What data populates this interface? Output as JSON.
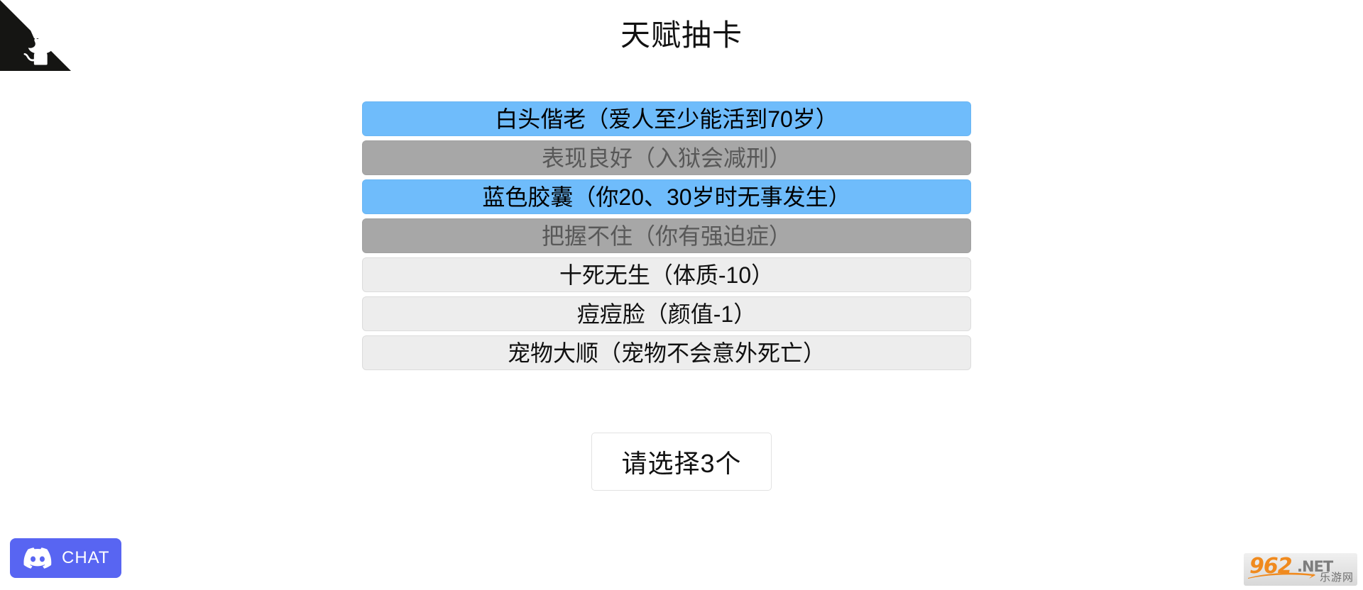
{
  "page": {
    "title": "天赋抽卡",
    "background_color": "#ffffff"
  },
  "github_corner": {
    "icon": "octocat-icon",
    "ribbon_color": "#151513",
    "mark_color": "#ffffff"
  },
  "cards": [
    {
      "label": "白头偕老（爱人至少能活到70岁）",
      "state": "selected",
      "color": "#6fbcfb"
    },
    {
      "label": "表现良好（入狱会减刑）",
      "state": "disabled",
      "color": "#a7a7a7"
    },
    {
      "label": "蓝色胶囊（你20、30岁时无事发生）",
      "state": "selected",
      "color": "#6fbcfb"
    },
    {
      "label": "把握不住（你有强迫症）",
      "state": "disabled",
      "color": "#a7a7a7"
    },
    {
      "label": "十死无生（体质-10）",
      "state": "normal",
      "color": "#ededed"
    },
    {
      "label": "痘痘脸（颜值-1）",
      "state": "normal",
      "color": "#ededed"
    },
    {
      "label": "宠物大顺（宠物不会意外死亡）",
      "state": "normal",
      "color": "#ededed"
    }
  ],
  "action": {
    "label": "请选择3个",
    "required_count": "3"
  },
  "discord": {
    "label": "CHAT",
    "icon": "discord-icon",
    "color": "#5865f2"
  },
  "watermark": {
    "number": "962",
    "tld": ".NET",
    "site_name": "乐游网",
    "accent_color": "#f08a1e"
  }
}
